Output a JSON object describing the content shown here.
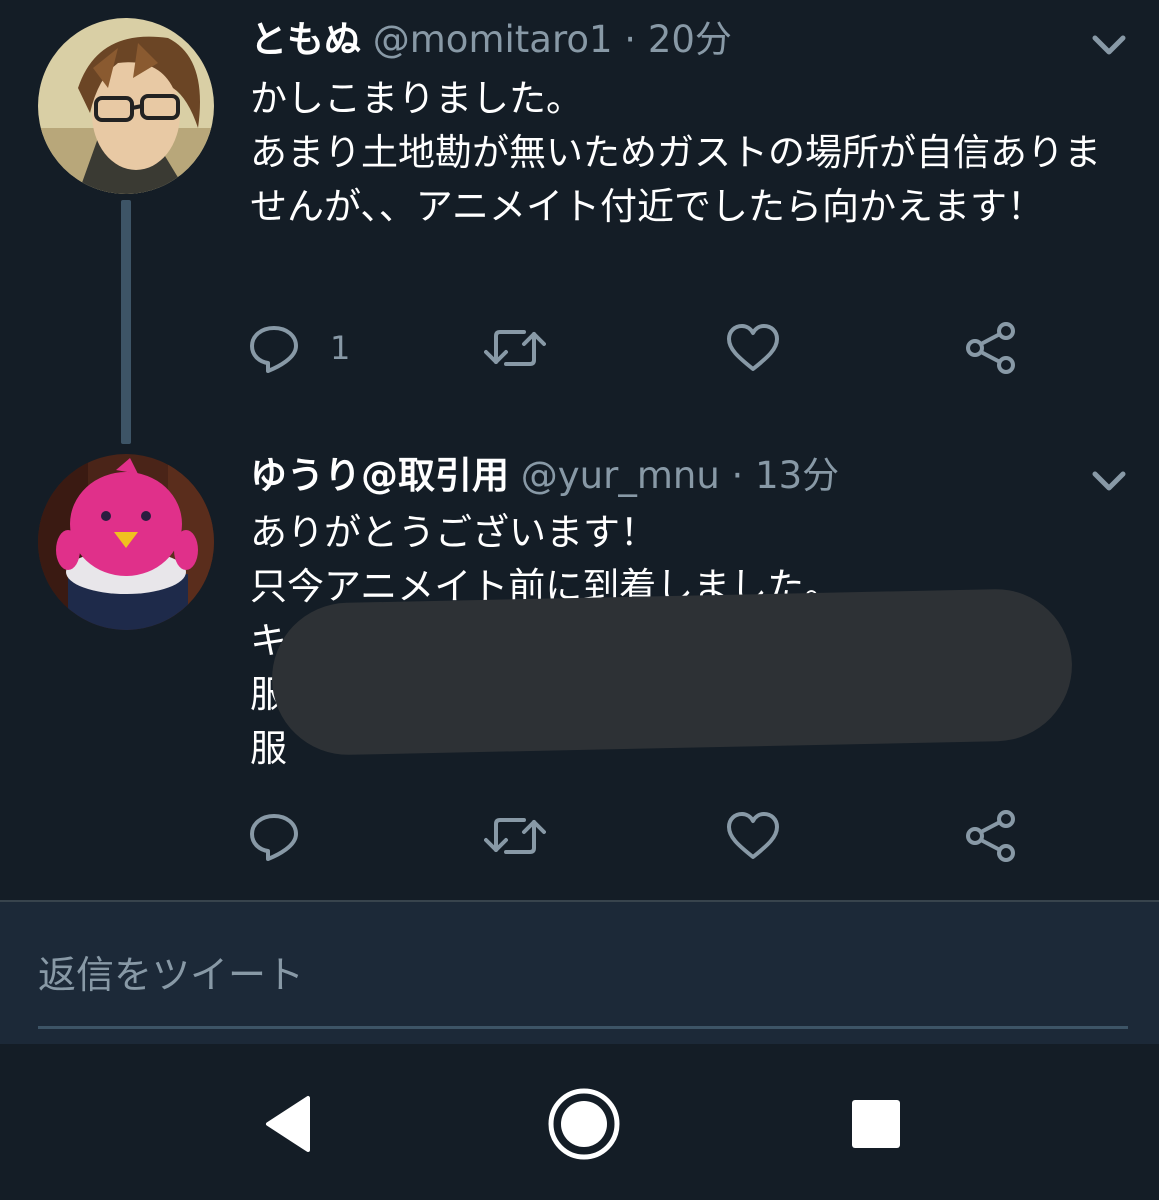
{
  "tweets": [
    {
      "name": "ともぬ",
      "handle": "@momitaro1",
      "separator": "·",
      "time": "20分",
      "text": "かしこまりました。\nあまり土地勘が無いためガストの場所が自信ありませんが、、アニメイト付近でしたら向かえます！",
      "reply_count": "1",
      "avatar_icon": "anime-character-avatar"
    },
    {
      "name": "ゆうり@取引用",
      "handle": "@yur_mnu",
      "separator": "·",
      "time": "13分",
      "text": "ありがとうございます！\n只今アニメイト前に到着しました。\nキ\n服　　　　　　　　　　　　　　　　　　　の\n服",
      "reply_count": "",
      "avatar_icon": "pink-bird-plush-avatar"
    }
  ],
  "reply_bar": {
    "placeholder": "返信をツイート"
  },
  "colors": {
    "background": "#141d26",
    "secondary_text": "#8899a6",
    "reply_bar_bg": "#1c2938",
    "thread_line": "#3d5466"
  }
}
